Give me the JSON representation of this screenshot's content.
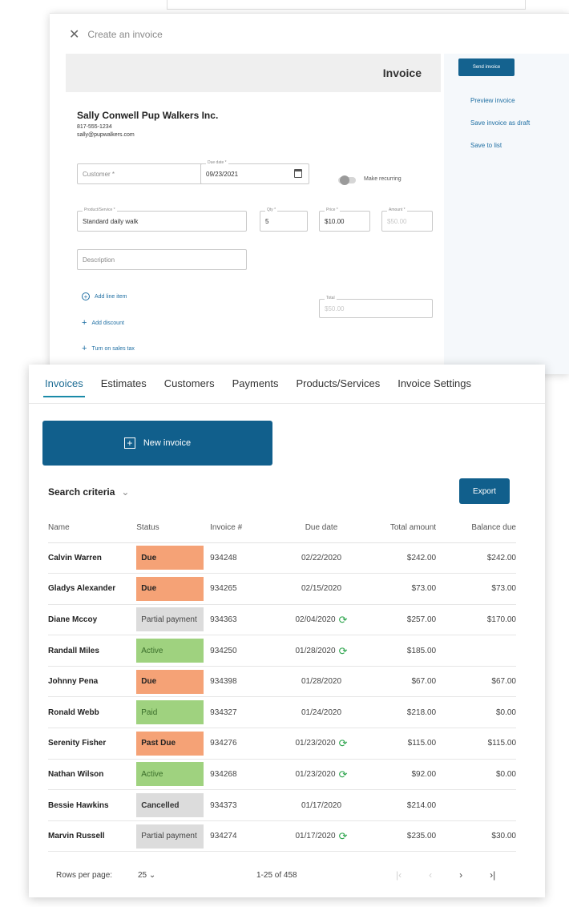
{
  "editor": {
    "header_title": "Create an invoice",
    "invoice_title": "Invoice",
    "company": {
      "name": "Sally Conwell Pup Walkers Inc.",
      "phone": "817-555-1234",
      "email": "sally@pupwalkers.com"
    },
    "fields": {
      "customer_placeholder": "Customer *",
      "due_date_label": "Due date *",
      "due_date_value": "09/23/2021",
      "make_recurring": "Make recurring",
      "product_label": "Product/Service *",
      "product_value": "Standard daily walk",
      "qty_label": "Qty *",
      "qty_value": "5",
      "price_label": "Price *",
      "price_value": "$10.00",
      "amount_label": "Amount *",
      "amount_value": "$50.00",
      "description_placeholder": "Description",
      "total_label": "Total",
      "total_value": "$50.00"
    },
    "links": {
      "add_line_item": "Add line item",
      "add_discount": "Add discount",
      "sales_tax": "Turn on sales tax"
    },
    "side": {
      "send_invoice": "Send invoice",
      "preview": "Preview invoice",
      "save_draft": "Save invoice as draft",
      "save_list": "Save to list"
    }
  },
  "tabs": [
    "Invoices",
    "Estimates",
    "Customers",
    "Payments",
    "Products/Services",
    "Invoice Settings"
  ],
  "new_invoice_label": "New invoice",
  "search_criteria_label": "Search criteria",
  "export_label": "Export",
  "table": {
    "headers": [
      "Name",
      "Status",
      "Invoice #",
      "Due date",
      "Total amount",
      "Balance due"
    ],
    "rows": [
      {
        "name": "Calvin Warren",
        "status": "Due",
        "kind": "due",
        "invoice": "934248",
        "due": "02/22/2020",
        "recurring": false,
        "total": "$242.00",
        "balance": "$242.00"
      },
      {
        "name": "Gladys Alexander",
        "status": "Due",
        "kind": "due",
        "invoice": "934265",
        "due": "02/15/2020",
        "recurring": false,
        "total": "$73.00",
        "balance": "$73.00"
      },
      {
        "name": "Diane Mccoy",
        "status": "Partial payment",
        "kind": "partial",
        "invoice": "934363",
        "due": "02/04/2020",
        "recurring": true,
        "total": "$257.00",
        "balance": "$170.00"
      },
      {
        "name": "Randall Miles",
        "status": "Active",
        "kind": "active",
        "invoice": "934250",
        "due": "01/28/2020",
        "recurring": true,
        "total": "$185.00",
        "balance": ""
      },
      {
        "name": "Johnny Pena",
        "status": "Due",
        "kind": "due",
        "invoice": "934398",
        "due": "01/28/2020",
        "recurring": false,
        "total": "$67.00",
        "balance": "$67.00"
      },
      {
        "name": "Ronald Webb",
        "status": "Paid",
        "kind": "paid",
        "invoice": "934327",
        "due": "01/24/2020",
        "recurring": false,
        "total": "$218.00",
        "balance": "$0.00"
      },
      {
        "name": "Serenity Fisher",
        "status": "Past Due",
        "kind": "due",
        "invoice": "934276",
        "due": "01/23/2020",
        "recurring": true,
        "total": "$115.00",
        "balance": "$115.00"
      },
      {
        "name": "Nathan Wilson",
        "status": "Active",
        "kind": "active",
        "invoice": "934268",
        "due": "01/23/2020",
        "recurring": true,
        "total": "$92.00",
        "balance": "$0.00"
      },
      {
        "name": "Bessie Hawkins",
        "status": "Cancelled",
        "kind": "cancelled",
        "invoice": "934373",
        "due": "01/17/2020",
        "recurring": false,
        "total": "$214.00",
        "balance": ""
      },
      {
        "name": "Marvin Russell",
        "status": "Partial payment",
        "kind": "partial",
        "invoice": "934274",
        "due": "01/17/2020",
        "recurring": true,
        "total": "$235.00",
        "balance": "$30.00"
      }
    ]
  },
  "footer": {
    "rows_per_page_label": "Rows per page:",
    "rows_per_page_value": "25",
    "range": "1-25 of 458"
  },
  "colors": {
    "primary": "#115f8c",
    "due": "#f5a276",
    "active": "#9fd27f",
    "neutral": "#dcdcdc",
    "recurring_icon": "#2aa34a"
  }
}
